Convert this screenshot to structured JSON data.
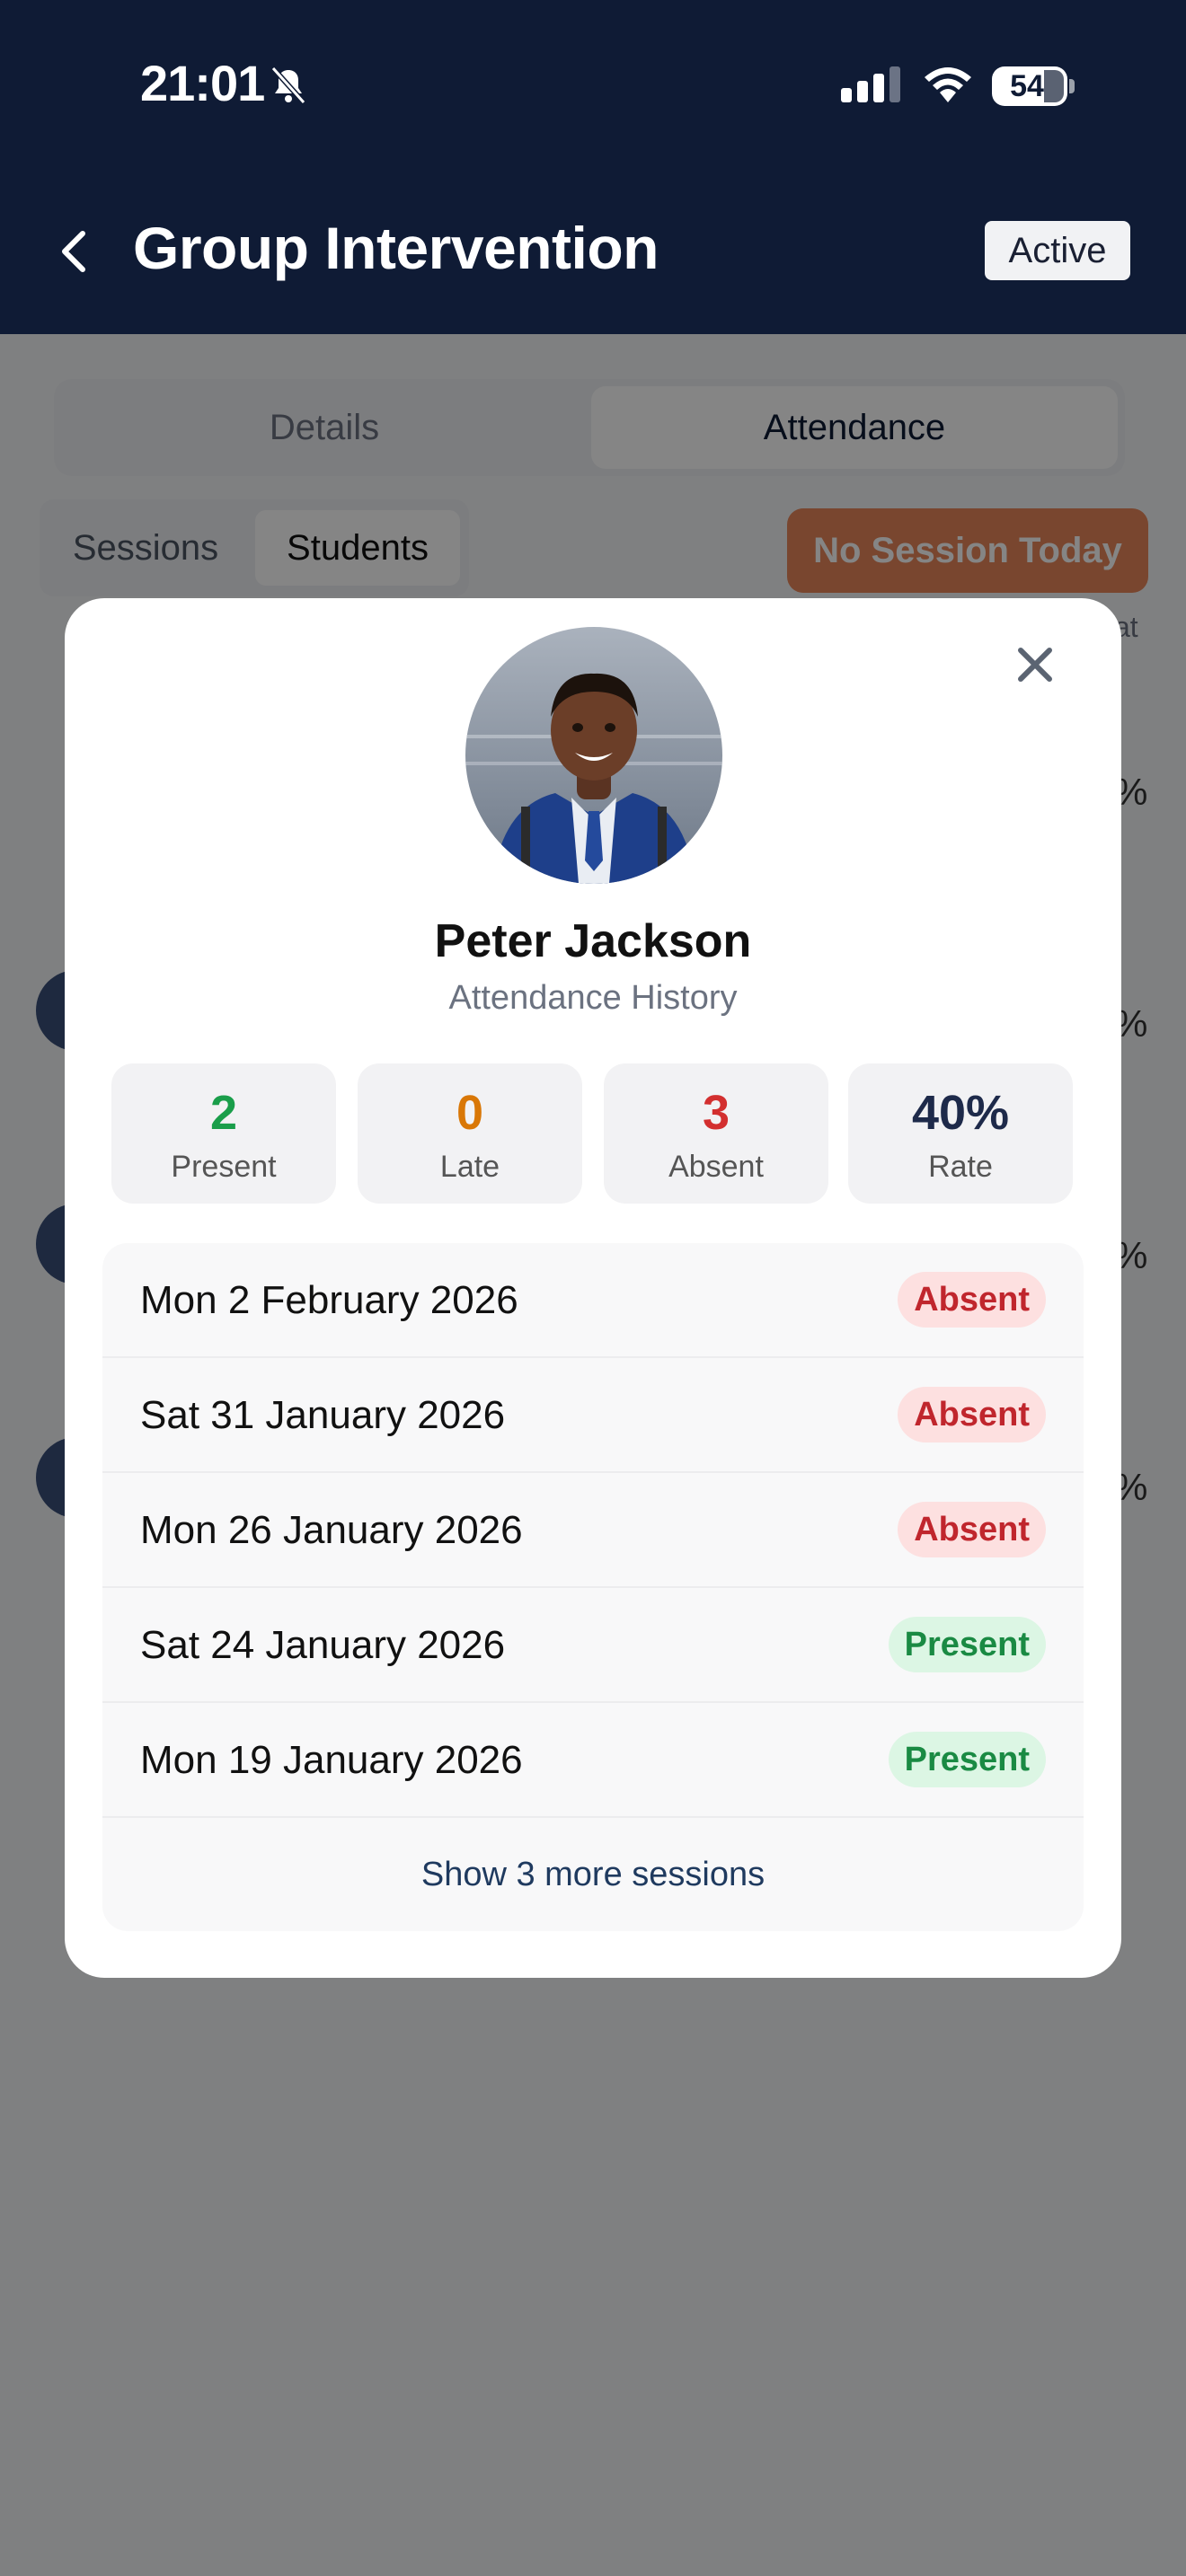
{
  "status_bar": {
    "time": "21:01",
    "battery": "54"
  },
  "header": {
    "title": "Group Intervention",
    "status": "Active"
  },
  "tabs": {
    "details": "Details",
    "attendance": "Attendance"
  },
  "subtabs": {
    "sessions": "Sessions",
    "students": "Students"
  },
  "session_button": "No Session Today",
  "background": {
    "column_peek": "at",
    "percent_peek": [
      "%",
      "%",
      "%",
      "%"
    ]
  },
  "modal": {
    "name": "Peter Jackson",
    "subtitle": "Attendance History",
    "stats": [
      {
        "value": "2",
        "label": "Present",
        "color": "#1a9e4a"
      },
      {
        "value": "0",
        "label": "Late",
        "color": "#d97706"
      },
      {
        "value": "3",
        "label": "Absent",
        "color": "#d32f2f"
      },
      {
        "value": "40%",
        "label": "Rate",
        "color": "#1e2a4a"
      }
    ],
    "sessions": [
      {
        "date": "Mon 2 February 2026",
        "status": "Absent"
      },
      {
        "date": "Sat 31 January 2026",
        "status": "Absent"
      },
      {
        "date": "Mon 26 January 2026",
        "status": "Absent"
      },
      {
        "date": "Sat 24 January 2026",
        "status": "Present"
      },
      {
        "date": "Mon 19 January 2026",
        "status": "Present"
      }
    ],
    "show_more": "Show 3 more sessions"
  }
}
